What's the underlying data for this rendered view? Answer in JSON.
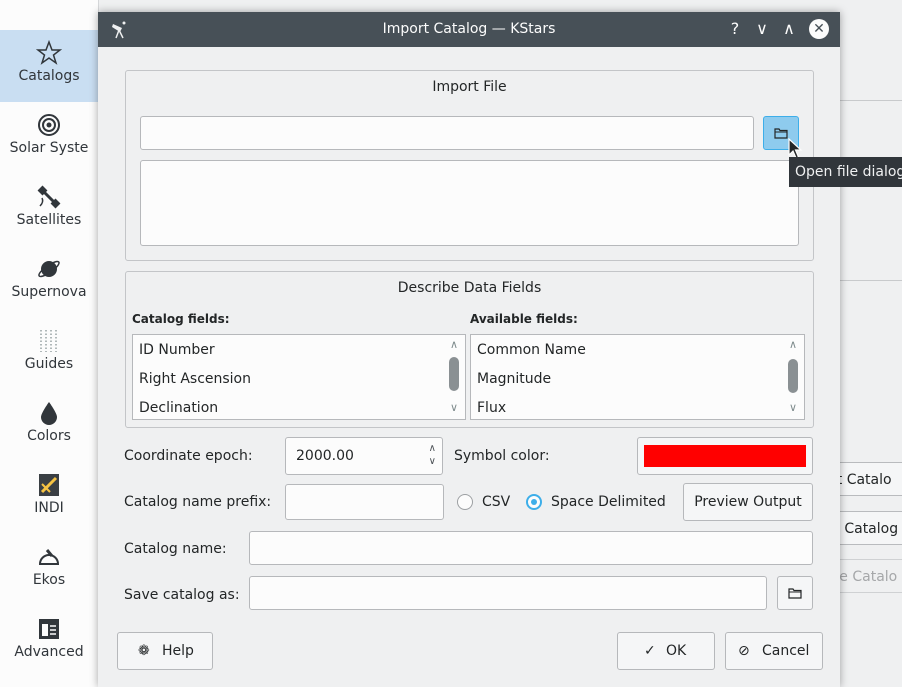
{
  "sidebar": {
    "items": [
      {
        "label": "Catalogs",
        "icon": "star-icon"
      },
      {
        "label": "Solar Syste",
        "icon": "solar-system-icon"
      },
      {
        "label": "Satellites",
        "icon": "satellite-icon"
      },
      {
        "label": "Supernova",
        "icon": "supernova-icon"
      },
      {
        "label": "Guides",
        "icon": "guides-icon"
      },
      {
        "label": "Colors",
        "icon": "color-drop-icon"
      },
      {
        "label": "INDI",
        "icon": "indi-icon"
      },
      {
        "label": "Ekos",
        "icon": "ekos-icon"
      },
      {
        "label": "Advanced",
        "icon": "advanced-icon"
      }
    ]
  },
  "background_buttons": {
    "import": "rt Catalo",
    "load": "d Catalog",
    "remove": "ve Catalo"
  },
  "dialog": {
    "title": "Import Catalog — KStars",
    "titlebar_buttons": {
      "help": "?",
      "minimize": "∨",
      "maximize": "∧",
      "close": "✕"
    },
    "import_file": {
      "group_title": "Import File",
      "path_value": "",
      "preview_text": ""
    },
    "tooltip": "Open file dialog",
    "data_fields": {
      "group_title": "Describe Data Fields",
      "catalog_fields_label": "Catalog fields:",
      "available_fields_label": "Available fields:",
      "catalog_fields": [
        "ID Number",
        "Right Ascension",
        "Declination"
      ],
      "available_fields": [
        "Common Name",
        "Magnitude",
        "Flux"
      ]
    },
    "coordinate_epoch": {
      "label": "Coordinate epoch:",
      "value": "2000.00"
    },
    "symbol_color": {
      "label": "Symbol color:",
      "color": "#ff0000"
    },
    "catalog_name_prefix": {
      "label": "Catalog name prefix:",
      "value": ""
    },
    "format": {
      "csv_label": "CSV",
      "space_label": "Space Delimited",
      "selected": "Space Delimited"
    },
    "preview_output_label": "Preview Output",
    "catalog_name": {
      "label": "Catalog name:",
      "value": ""
    },
    "save_catalog_as": {
      "label": "Save catalog as:",
      "value": ""
    },
    "buttons": {
      "help": "Help",
      "ok": "OK",
      "cancel": "Cancel"
    }
  },
  "colors": {
    "accent": "#3daee9",
    "titlebar": "#475057",
    "sidebar_active": "#c9def2",
    "tooltip_bg": "#31363b"
  }
}
